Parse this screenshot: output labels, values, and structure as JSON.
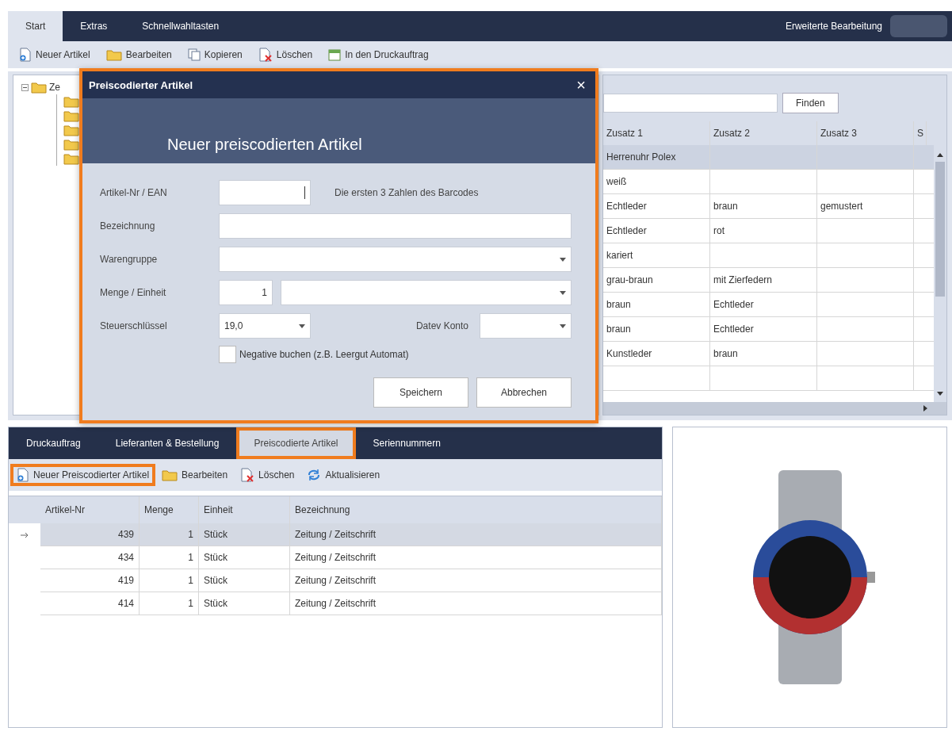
{
  "tabs": [
    {
      "label": "Start",
      "selected": true
    },
    {
      "label": "Extras",
      "selected": false
    },
    {
      "label": "Schnellwahltasten",
      "selected": false
    }
  ],
  "header_right": {
    "label": "Erweiterte Bearbeitung"
  },
  "toolbar": [
    {
      "label": "Neuer Artikel",
      "kind": "new"
    },
    {
      "label": "Bearbeiten",
      "kind": "edit"
    },
    {
      "label": "Kopieren",
      "kind": "copy"
    },
    {
      "label": "Löschen",
      "kind": "delete"
    },
    {
      "label": "In den Druckauftrag",
      "kind": "print"
    }
  ],
  "tree": {
    "label": "Ze",
    "expanded": true,
    "children": [
      {
        "kind": "folder"
      },
      {
        "kind": "folder"
      },
      {
        "kind": "folder"
      },
      {
        "kind": "folder"
      },
      {
        "kind": "folder"
      }
    ]
  },
  "search": {
    "button": "Finden"
  },
  "grid": {
    "columns": [
      "Zusatz 1",
      "Zusatz 2",
      "Zusatz 3",
      "S"
    ],
    "rows": [
      {
        "cells": [
          "Herrenuhr Polex",
          "",
          ""
        ],
        "selected": true
      },
      {
        "cells": [
          "weiß",
          "",
          ""
        ],
        "selected": false
      },
      {
        "cells": [
          "Echtleder",
          "braun",
          "gemustert"
        ],
        "selected": false
      },
      {
        "cells": [
          "Echtleder",
          "rot",
          ""
        ],
        "selected": false
      },
      {
        "cells": [
          "kariert",
          "",
          ""
        ],
        "selected": false
      },
      {
        "cells": [
          "grau-braun",
          "mit Zierfedern",
          ""
        ],
        "selected": false
      },
      {
        "cells": [
          "braun",
          "Echtleder",
          ""
        ],
        "selected": false
      },
      {
        "cells": [
          "braun",
          "Echtleder",
          ""
        ],
        "selected": false
      },
      {
        "cells": [
          "Kunstleder",
          "braun",
          ""
        ],
        "selected": false
      },
      {
        "cells": [
          "",
          "",
          ""
        ],
        "selected": false
      }
    ]
  },
  "dialog": {
    "title": "Preiscodierter Artikel",
    "close": "×",
    "heading": "Neuer preiscodierten Artikel",
    "highlighted": true,
    "fields": [
      {
        "kind": "text",
        "label": "Artikel-Nr / EAN",
        "hint": "Die ersten 3 Zahlen des Barcodes",
        "focused": true
      },
      {
        "kind": "text-wide",
        "label": "Bezeichnung"
      },
      {
        "kind": "dropdown",
        "label": "Warengruppe"
      },
      {
        "kind": "amount-unit",
        "label": "Menge / Einheit",
        "value": "1"
      },
      {
        "kind": "tax",
        "label": "Steuerschlüssel",
        "value": "19,0",
        "second_label": "Datev Konto"
      }
    ],
    "checkbox": {
      "label": "Negative buchen (z.B. Leergut Automat)",
      "checked": false
    },
    "buttons": [
      "Speichern",
      "Abbrechen"
    ]
  },
  "bottom_tabs": [
    {
      "label": "Druckauftrag",
      "selected": false,
      "highlighted": false
    },
    {
      "label": "Lieferanten & Bestellung",
      "selected": false,
      "highlighted": false
    },
    {
      "label": "Preiscodierte Artikel",
      "selected": true,
      "highlighted": true
    },
    {
      "label": "Seriennummern",
      "selected": false,
      "highlighted": false
    }
  ],
  "bottom_toolbar": [
    {
      "label": "Neuer Preiscodierter Artikel",
      "kind": "new",
      "highlighted": true
    },
    {
      "label": "Bearbeiten",
      "kind": "edit",
      "highlighted": false
    },
    {
      "label": "Löschen",
      "kind": "delete",
      "highlighted": false
    },
    {
      "label": "Aktualisieren",
      "kind": "refresh",
      "highlighted": false
    }
  ],
  "table": {
    "columns": [
      "Artikel-Nr",
      "Menge",
      "Einheit",
      "Bezeichnung"
    ],
    "rows": [
      {
        "cells": [
          "439",
          "1",
          "Stück",
          "Zeitung / Zeitschrift"
        ],
        "selected": true
      },
      {
        "cells": [
          "434",
          "1",
          "Stück",
          "Zeitung / Zeitschrift"
        ],
        "selected": false
      },
      {
        "cells": [
          "419",
          "1",
          "Stück",
          "Zeitung / Zeitschrift"
        ],
        "selected": false
      },
      {
        "cells": [
          "414",
          "1",
          "Stück",
          "Zeitung / Zeitschrift"
        ],
        "selected": false
      }
    ]
  }
}
